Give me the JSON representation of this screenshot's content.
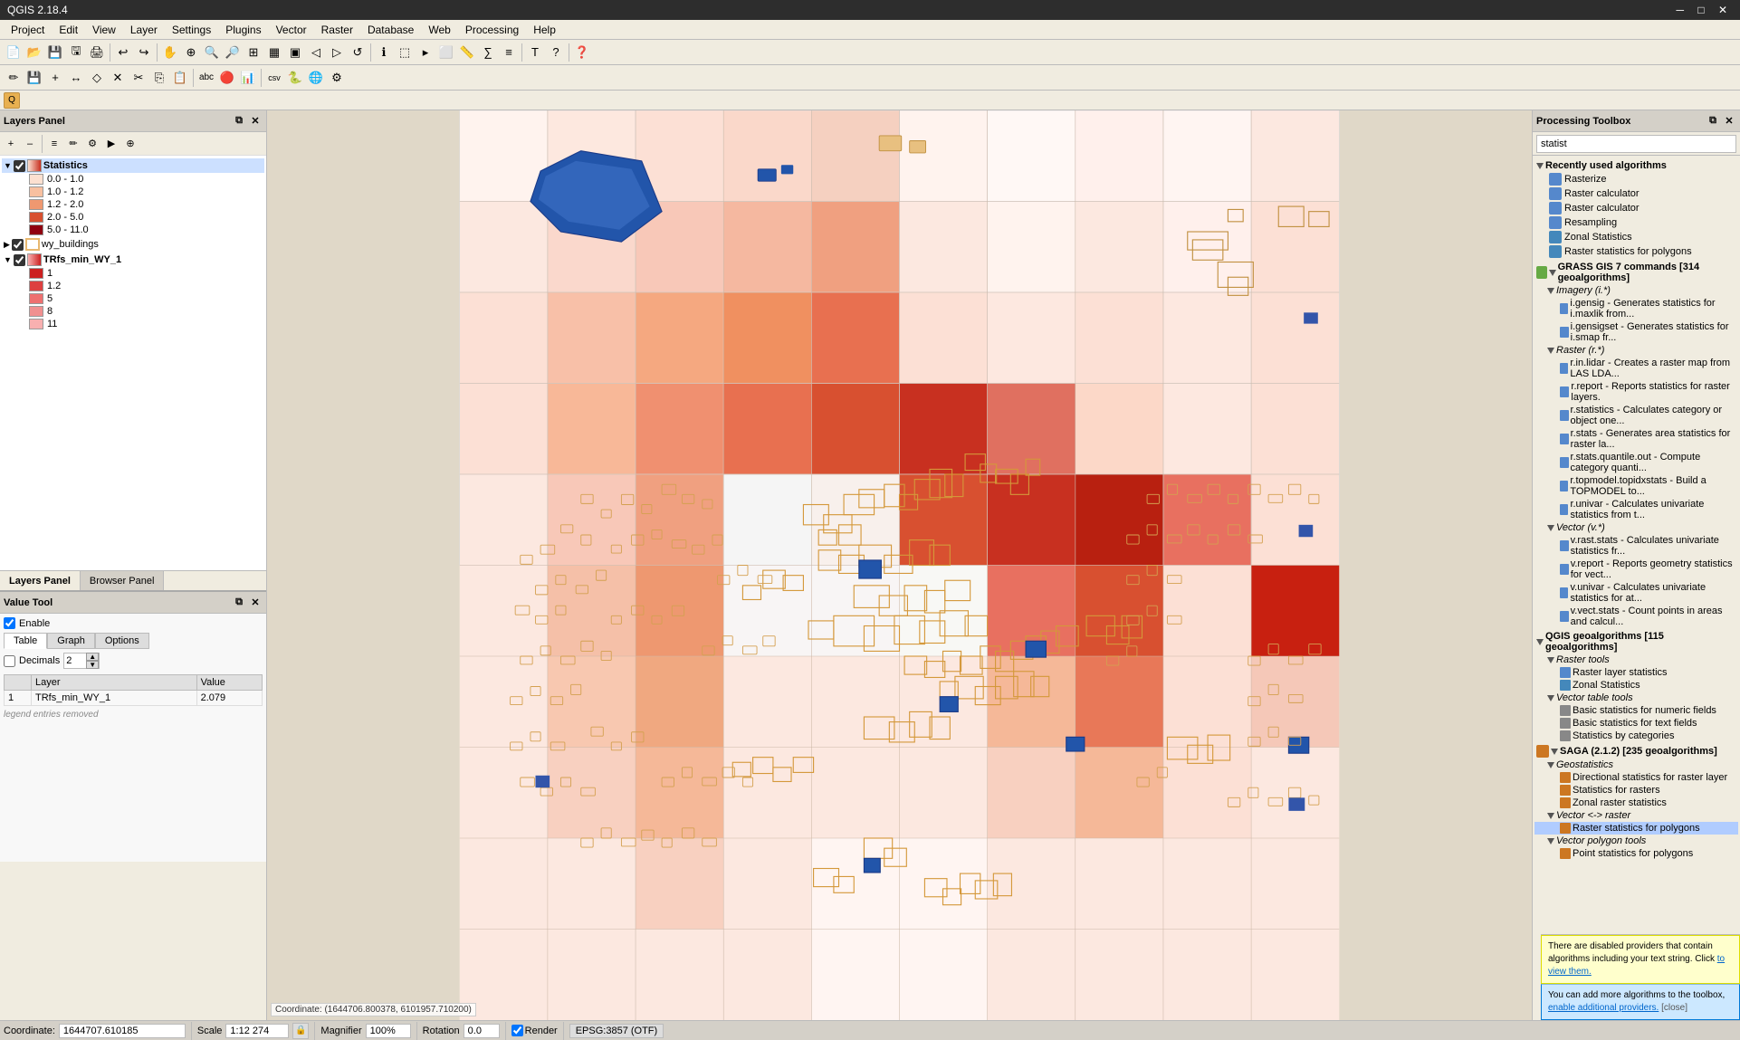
{
  "title": "QGIS 2.18.4",
  "titlebar": {
    "title": "QGIS 2.18.4",
    "controls": [
      "─",
      "□",
      "✕"
    ]
  },
  "menubar": {
    "items": [
      "Project",
      "Edit",
      "View",
      "Layer",
      "Settings",
      "Plugins",
      "Vector",
      "Raster",
      "Database",
      "Web",
      "Processing",
      "Help"
    ]
  },
  "layers_panel": {
    "title": "Layers Panel",
    "layers": [
      {
        "name": "Statistics",
        "checked": true,
        "expanded": true,
        "legend": [
          {
            "label": "0.0 - 1.0",
            "color": "#f5dbd0"
          },
          {
            "label": "1.0 - 1.2",
            "color": "#e8b8a0"
          },
          {
            "label": "1.2 - 2.0",
            "color": "#d89070"
          },
          {
            "label": "2.0 - 5.0",
            "color": "#c05030"
          },
          {
            "label": "5.0 - 11.0",
            "color": "#901020"
          }
        ]
      },
      {
        "name": "wy_buildings",
        "checked": true,
        "expanded": false
      },
      {
        "name": "TRfs_min_WY_1",
        "checked": true,
        "expanded": true,
        "legend": [
          {
            "label": "1",
            "color": "#cc2020"
          },
          {
            "label": "1.2",
            "color": "#dd4040"
          },
          {
            "label": "5",
            "color": "#ee7070"
          },
          {
            "label": "8",
            "color": "#f09090"
          },
          {
            "label": "11",
            "color": "#f8b0b0"
          }
        ]
      }
    ]
  },
  "panel_tabs": [
    {
      "label": "Layers Panel",
      "active": true
    },
    {
      "label": "Browser Panel",
      "active": false
    }
  ],
  "value_tool": {
    "title": "Value Tool",
    "enable_label": "Enable",
    "tabs": [
      "Table",
      "Graph",
      "Options"
    ],
    "active_tab": "Table",
    "decimals_label": "Decimals",
    "decimals_value": "2",
    "table_headers": [
      "",
      "Layer",
      "Value"
    ],
    "table_rows": [
      {
        "num": "1",
        "layer": "TRfs_min_WY_1",
        "value": "2.079"
      }
    ]
  },
  "processing_toolbox": {
    "title": "Processing Toolbox",
    "search_placeholder": "statist",
    "groups": [
      {
        "label": "Recently used algorithms",
        "expanded": true,
        "items": [
          {
            "icon": "raster",
            "label": "Rasterize"
          },
          {
            "icon": "raster_calc",
            "label": "Raster calculator"
          },
          {
            "icon": "raster_calc",
            "label": "Raster calculator"
          },
          {
            "icon": "resample",
            "label": "Resampling"
          },
          {
            "icon": "zonal",
            "label": "Zonal Statistics"
          },
          {
            "icon": "raster_poly",
            "label": "Raster statistics for polygons"
          }
        ]
      },
      {
        "label": "GRASS GIS 7 commands [314 geoalgorithms]",
        "expanded": true,
        "subgroups": [
          {
            "label": "Imagery (i.*)",
            "expanded": true,
            "items": [
              {
                "label": "i.gensig - Generates statistics for i.maxlik from..."
              },
              {
                "label": "i.gensigset - Generates statistics for i.smap fr..."
              }
            ]
          },
          {
            "label": "Raster (r.*)",
            "expanded": true,
            "items": [
              {
                "label": "r.in.lidar - Creates a raster map from LAS LDA..."
              },
              {
                "label": "r.report - Reports statistics for raster layers."
              },
              {
                "label": "r.statistics - Calculates category or object one..."
              },
              {
                "label": "r.stats - Generates area statistics for raster la..."
              },
              {
                "label": "r.stats.quantile.out - Compute category quanti..."
              },
              {
                "label": "r.topmodel.topidxstats - Build a TOPMODEL to..."
              },
              {
                "label": "r.univar - Calculates univariate statistics from t..."
              }
            ]
          },
          {
            "label": "Vector (v.*)",
            "expanded": true,
            "items": [
              {
                "label": "v.rast.stats - Calculates univariate statistics fr..."
              },
              {
                "label": "v.report - Reports geometry statistics for vect..."
              },
              {
                "label": "v.univar - Calculates univariate statistics for at..."
              },
              {
                "label": "v.vect.stats - Count points in areas and calcul..."
              }
            ]
          }
        ]
      },
      {
        "label": "QGIS geoalgorithms [115 geoalgorithms]",
        "expanded": true,
        "subgroups": [
          {
            "label": "Raster tools",
            "expanded": true,
            "items": [
              {
                "label": "Raster layer statistics"
              },
              {
                "label": "Zonal Statistics"
              }
            ]
          },
          {
            "label": "Vector table tools",
            "expanded": true,
            "items": [
              {
                "label": "Basic statistics for numeric fields"
              },
              {
                "label": "Basic statistics for text fields"
              },
              {
                "label": "Statistics by categories"
              }
            ]
          }
        ]
      },
      {
        "label": "SAGA (2.1.2) [235 geoalgorithms]",
        "expanded": true,
        "subgroups": [
          {
            "label": "Geostatistics",
            "expanded": true,
            "items": [
              {
                "label": "Directional statistics for raster layer"
              },
              {
                "label": "Statistics for rasters"
              },
              {
                "label": "Zonal raster statistics"
              }
            ]
          },
          {
            "label": "Vector <-> raster",
            "expanded": true,
            "items": [
              {
                "label": "Raster statistics for polygons",
                "highlighted": true
              }
            ]
          },
          {
            "label": "Vector polygon tools",
            "expanded": true,
            "items": [
              {
                "label": "Point statistics for polygons"
              }
            ]
          }
        ]
      }
    ]
  },
  "statusbar": {
    "coordinate_label": "Coordinate:",
    "coordinate_value": "1644707.610185",
    "scale_label": "Scale",
    "scale_value": "1:12 274",
    "magnifier_label": "Magnifier",
    "magnifier_value": "100%",
    "rotation_label": "Rotation",
    "rotation_value": "0.0",
    "render_label": "Render",
    "epsg_label": "EPSG:3857 (OTF)"
  },
  "notifications": [
    {
      "type": "yellow",
      "text": "There are disabled providers that contain algorithms including your text string. Click ",
      "link": "to view them.",
      "text2": ""
    },
    {
      "type": "blue",
      "text": "You can add more algorithms to the toolbox, ",
      "link": "enable additional providers.",
      "text2": " [close]"
    }
  ],
  "legend_colors": {
    "stat_0": "#fce8e0",
    "stat_1": "#f8cbb8",
    "stat_2": "#f5a880",
    "stat_3": "#ee7050",
    "stat_4": "#d83020",
    "stat_5": "#a01010",
    "building_tan": "#e8b870",
    "building_blue": "#223388"
  }
}
